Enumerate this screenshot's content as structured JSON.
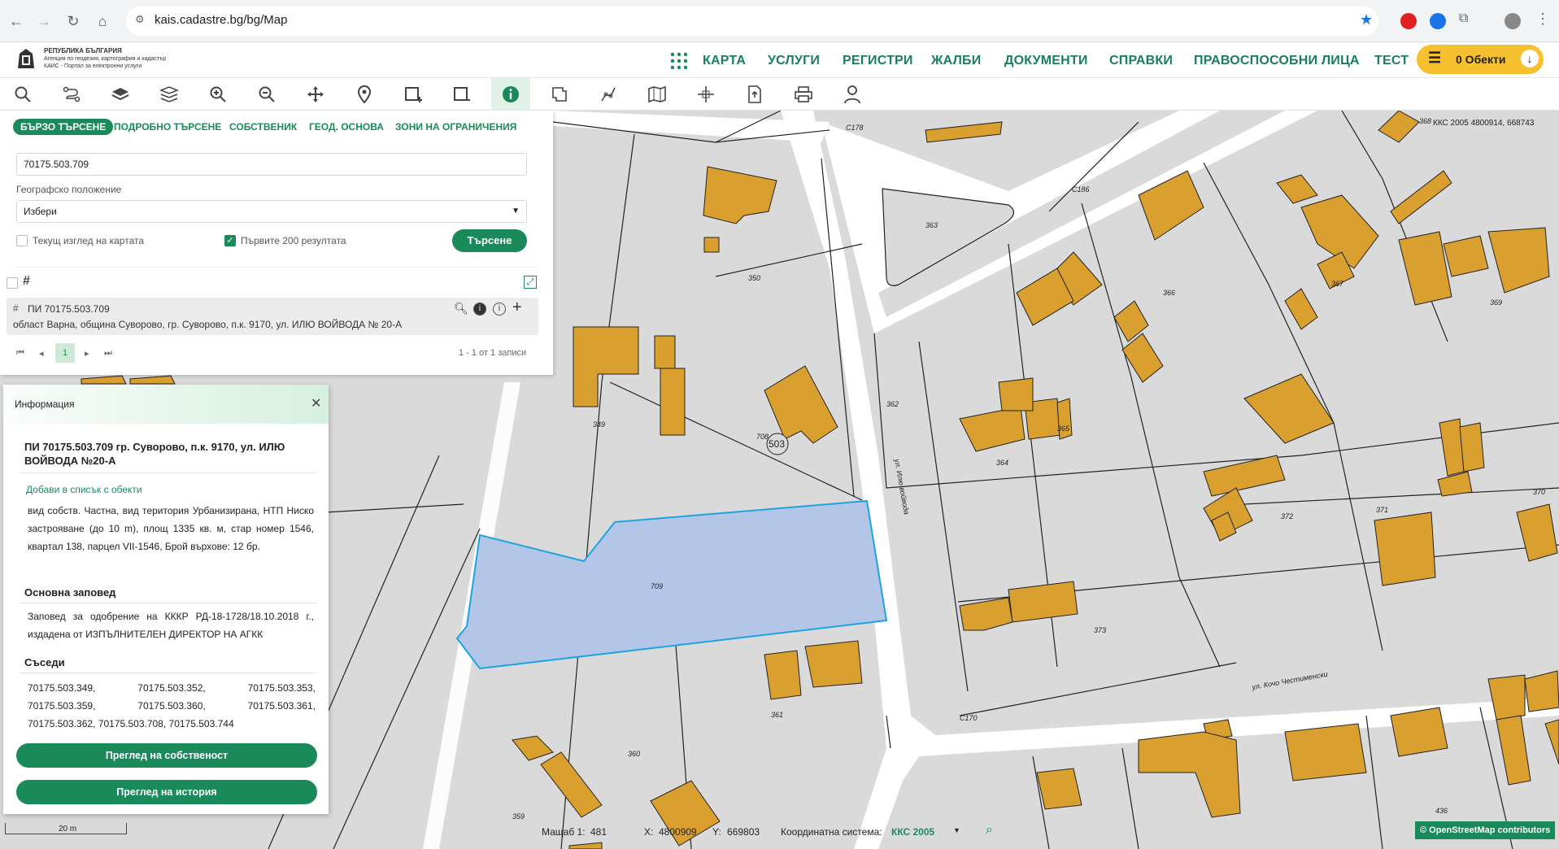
{
  "browser": {
    "url": "kais.cadastre.bg/bg/Map"
  },
  "app": {
    "logo_title": "РЕПУБЛИКА БЪЛГАРИЯ",
    "logo_sub1": "Агенция по геодезия, картография и кадастър",
    "logo_sub2": "КАИС - Портал за електронни услуги",
    "nav": [
      "КАРТА",
      "УСЛУГИ",
      "РЕГИСТРИ",
      "ЖАЛБИ",
      "ДОКУМЕНТИ",
      "СПРАВКИ",
      "ПРАВОСПОСОБНИ ЛИЦА",
      "ТЕСТ"
    ],
    "cart_label": "0 Обекти"
  },
  "toolbar": {
    "tools": [
      "search-icon",
      "route-icon",
      "layers-icon",
      "layers-stack-icon",
      "zoom-in-icon",
      "zoom-out-icon",
      "pan-icon",
      "location-pin-icon",
      "select-rectangle-icon",
      "select-polygon-icon",
      "info-icon",
      "measure-icon",
      "draw-icon",
      "map-icon",
      "crosshair-icon",
      "export-icon",
      "print-icon",
      "user-icon"
    ]
  },
  "search": {
    "tabs": [
      "БЪРЗО ТЪРСЕНЕ",
      "ПОДРОБНО ТЪРСЕНЕ",
      "СОБСТВЕНИК",
      "ГЕОД. ОСНОВА",
      "ЗОНИ НА ОГРАНИЧЕНИЯ"
    ],
    "query": "70175.503.709",
    "geo_label": "Географско положение",
    "geo_value": "Избери",
    "current_view_label": "Текущ изглед на картата",
    "first200_label": "Първите 200 резултата",
    "search_button": "Търсене",
    "result_title": "ПИ 70175.503.709",
    "result_address": "област Варна, община Суворово, гр. Суворово, п.к. 9170, ул. ИЛЮ ВОЙВОДА № 20-А",
    "page": "1",
    "records": "1 - 1 от 1 записи"
  },
  "info": {
    "title": "Информация",
    "heading": "ПИ 70175.503.709 гр. Суворово, п.к. 9170, ул. ИЛЮ ВОЙВОДА №20-А",
    "add_link": "Добави в списък с обекти",
    "description": "вид собств. Частна, вид територия Урбанизирана, НТП Ниско застрояване (до 10 m), площ 1335 кв. м, стар номер 1546, квартал 138, парцел VII-1546, Брой върхове: 12 бр.",
    "order_heading": "Основна заповед",
    "order_text": "Заповед за одобрение на КККР РД-18-1728/18.10.2018 г., издадена от ИЗПЪЛНИТЕЛЕН ДИРЕКТОР НА АГКК",
    "neighbors_heading": "Съседи",
    "neighbors": [
      "70175.503.349,",
      "70175.503.352,",
      "70175.503.353,",
      "70175.503.359,",
      "70175.503.360,",
      "70175.503.361,",
      "70175.503.362,",
      "70175.503.708,",
      "70175.503.744"
    ],
    "btn_ownership": "Преглед на собственост",
    "btn_history": "Преглед на история"
  },
  "map": {
    "parcels": [
      "350",
      "349",
      "362",
      "363",
      "364",
      "365",
      "366",
      "367",
      "368",
      "369",
      "370",
      "371",
      "372",
      "373",
      "359",
      "360",
      "361",
      "436",
      "709",
      "708"
    ],
    "block_label": "503",
    "streets": [
      "ул. Илю войвода",
      "ул. Кочо Честименски"
    ],
    "markers": [
      "С178",
      "С186",
      "С170"
    ],
    "coords_topright": "ККС 2005 4800914, 668743",
    "selected_parcel": "709"
  },
  "status": {
    "scale_label": "Мащаб 1:",
    "scale_value": "481",
    "x_label": "X:",
    "x_value": "4800909",
    "y_label": "Y:",
    "y_value": "669803",
    "crs_label": "Координатна система:",
    "crs_value": "ККС 2005",
    "scalebar_text": "20 m",
    "osm": "© OpenStreetMap contributors"
  },
  "colors": {
    "accent": "#1a8a5a",
    "building": "#d9a030",
    "selection": "#b3c6e7",
    "cart": "#f6c02e"
  }
}
